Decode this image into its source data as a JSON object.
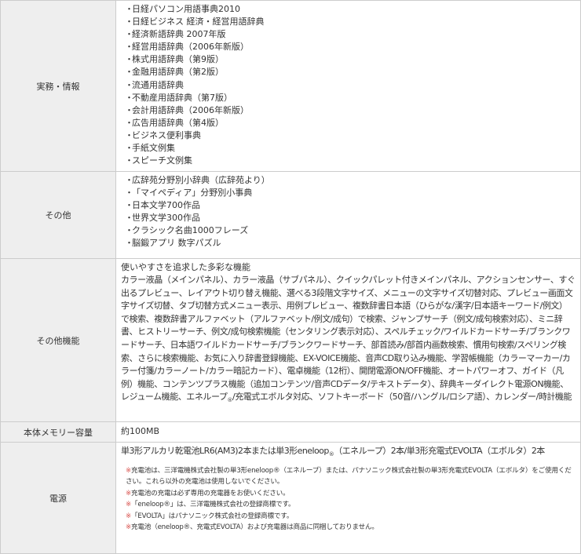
{
  "rows": {
    "business": {
      "label": "実務・情報",
      "items": [
        "日経パソコン用語事典2010",
        "日経ビジネス 経済・経営用語辞典",
        "経済新語辞典 2007年版",
        "経営用語辞典（2006年新版）",
        "株式用語辞典（第9版）",
        "金融用語辞典（第2版）",
        "流通用語辞典",
        "不動産用語辞典（第7版）",
        "会計用語辞典（2006年新版）",
        "広告用語辞典（第4版）",
        "ビジネス便利事典",
        "手紙文例集",
        "スピーチ文例集"
      ]
    },
    "other": {
      "label": "その他",
      "items": [
        "広辞苑分野別小辞典（広辞苑より）",
        "「マイペディア」分野別小事典",
        "日本文学700作品",
        "世界文学300作品",
        "クラシック名曲1000フレーズ",
        "脳鍛アプリ 数字パズル"
      ]
    },
    "features": {
      "label": "その他機能",
      "title": "使いやすさを追求した多彩な機能",
      "body_1": "カラー液晶（メインパネル）、カラー液晶（サブパネル）、クイックパレット付きメインパネル、アクションセンサー、すぐ出るプレビュー、レイアウト切り替え機能、選べる3段階文字サイズ、メニューの文字サイズ切替対応、プレビュー画面文字サイズ切替、タブ切替方式メニュー表示、用例プレビュー、複数辞書日本語（ひらがな/漢字/日本語キーワード/例文）で検索、複数辞書アルファベット（アルファベット/例文/成句）で検索、ジャンプサーチ（例文/成句検索対応）、ミニ辞書、ヒストリーサーチ、例文/成句検索機能（センタリング表示対応）、スペルチェック/ワイルドカードサーチ/ブランクワードサーチ、日本語ワイルドカードサーチ/ブランクワードサーチ、部首読み/部首内画数検索、慣用句検索/スペリング検索、さらに検索機能、お気に入り辞書登録機能、EX-VOICE機能、音声CD取り込み機能、学習帳機能（カラーマーカー/カラー付箋/カラーノート/カラー暗記カード）、電卓機能（12桁）、開閉電源ON/OFF機能、オートパワーオフ、ガイド（凡例）機能、コンテンツプラス機能（追加コンテンツ/音声CDデータ/テキストデータ）、辞典キーダイレクト電源ON機能、レジューム機能、エネループ",
      "registered_mark": "®",
      "body_2": "/充電式エボルタ対応、ソフトキーボード（50音/ハングル/ロシア語）、カレンダー/時計機能"
    },
    "memory": {
      "label": "本体メモリー容量",
      "value": "約100MB"
    },
    "power": {
      "label": "電源",
      "main_1": "単3形アルカリ乾電池LR6(AM3)2本または単3形eneloop",
      "registered_mark": "®",
      "main_2": "（エネループ）2本/単3形充電式EVOLTA（エボルタ）2本",
      "asterisk": "※",
      "notes": [
        "充電池は、三洋電機株式会社製の単3形eneloop®（エネループ）または、パナソニック株式会社製の単3形充電式EVOLTA（エボルタ）をご使用ください。これら以外の充電池は使用しないでください。",
        "充電池の充電は必ず専用の充電器をお使いください。",
        "「eneloop®」は、三洋電機株式会社の登録商標です。",
        "「EVOLTA」はパナソニック株式会社の登録商標です。",
        "充電池（eneloop®、充電式EVOLTA）および充電器は商品に同梱しておりません。"
      ]
    }
  },
  "bullet": "・"
}
